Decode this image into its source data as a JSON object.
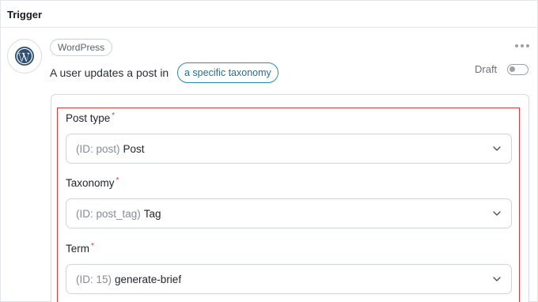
{
  "section_title": "Trigger",
  "integration": {
    "badge": "WordPress",
    "icon": "wordpress-logo-icon"
  },
  "trigger": {
    "sentence": "A user updates a post in",
    "taxonomy_pill": "a specific taxonomy"
  },
  "status": {
    "label": "Draft",
    "toggle_on": false
  },
  "fields": [
    {
      "label": "Post type",
      "required_mark": "*",
      "id_text": "(ID: post)",
      "value": "Post"
    },
    {
      "label": "Taxonomy",
      "required_mark": "*",
      "id_text": "(ID: post_tag)",
      "value": "Tag"
    },
    {
      "label": "Term",
      "required_mark": "*",
      "id_text": "(ID: 15)",
      "value": "generate-brief"
    }
  ],
  "colors": {
    "accent": "#2b8ab5",
    "required": "#e0393e",
    "highlight_border": "#e0393e"
  }
}
